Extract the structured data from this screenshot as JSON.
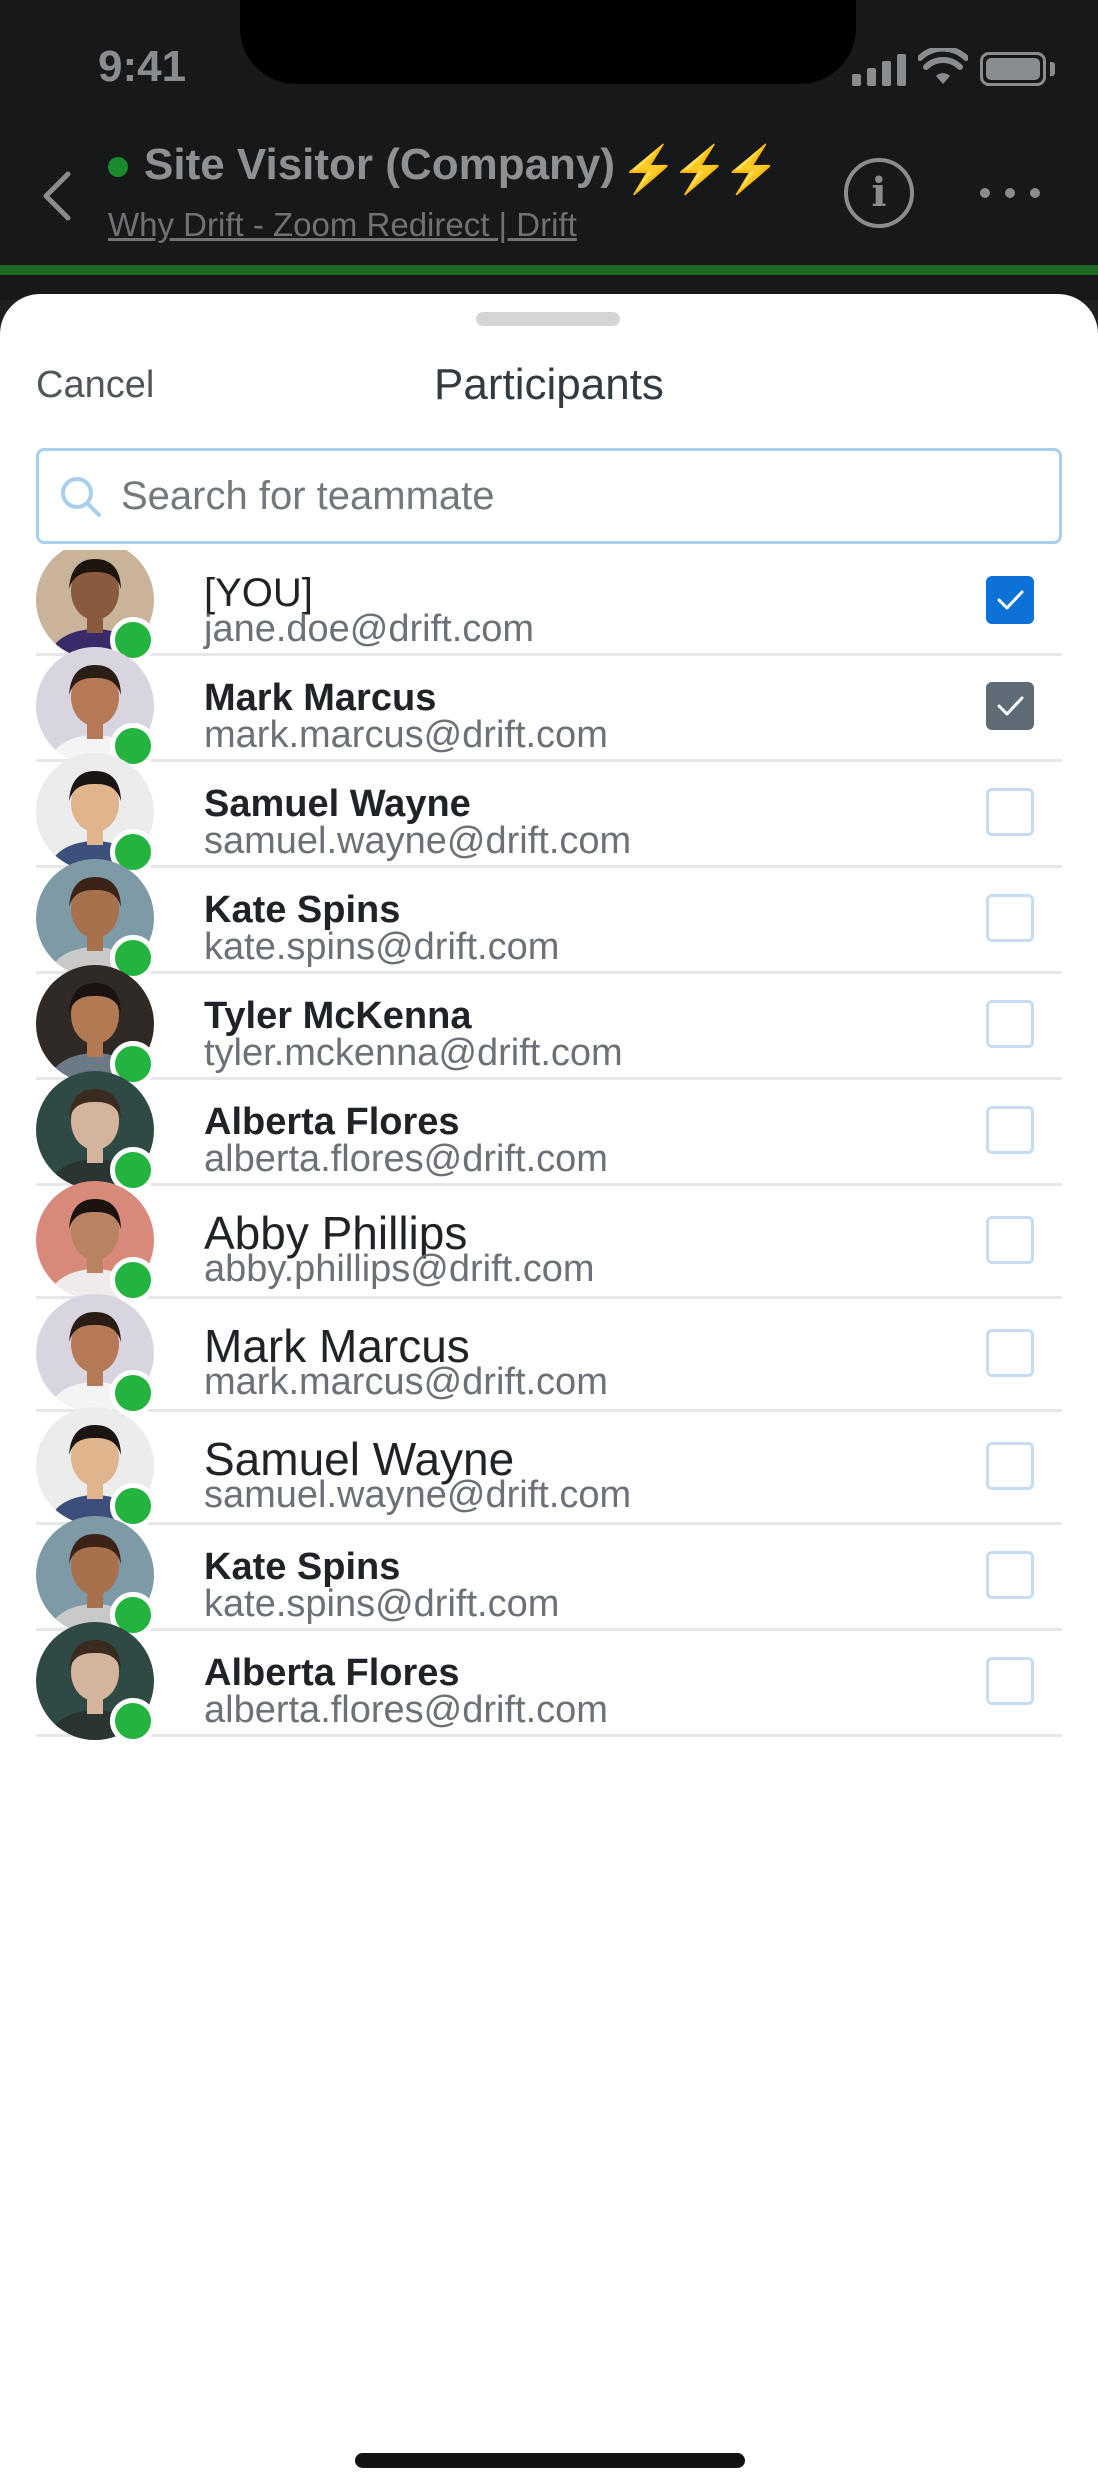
{
  "status_bar": {
    "time": "9:41"
  },
  "conversation": {
    "title": "Site Visitor (Company)",
    "bolts": "⚡⚡⚡",
    "subtitle": "Why Drift - Zoom Redirect | Drift",
    "colors": {
      "online": "#1a8a2c",
      "stripe": "#1f6a22"
    }
  },
  "sheet": {
    "cancel_label": "Cancel",
    "title": "Participants",
    "search": {
      "placeholder": "Search for teammate",
      "value": ""
    }
  },
  "participants": [
    {
      "name": "[YOU]",
      "email": "jane.doe@drift.com",
      "checked": true,
      "check_style": "blue",
      "avatar": "avatar-jane",
      "name_style": "regular"
    },
    {
      "name": "Mark Marcus",
      "email": "mark.marcus@drift.com",
      "checked": true,
      "check_style": "gray",
      "avatar": "avatar-mark",
      "name_style": "bold"
    },
    {
      "name": "Samuel Wayne",
      "email": "samuel.wayne@drift.com",
      "checked": false,
      "avatar": "avatar-samuel",
      "name_style": "bold"
    },
    {
      "name": "Kate Spins",
      "email": "kate.spins@drift.com",
      "checked": false,
      "avatar": "avatar-kate",
      "name_style": "bold"
    },
    {
      "name": "Tyler McKenna",
      "email": "tyler.mckenna@drift.com",
      "checked": false,
      "avatar": "avatar-tyler",
      "name_style": "bold"
    },
    {
      "name": "Alberta Flores",
      "email": "alberta.flores@drift.com",
      "checked": false,
      "avatar": "avatar-alberta",
      "name_style": "bold"
    },
    {
      "name": "Abby Phillips",
      "email": "abby.phillips@drift.com",
      "checked": false,
      "avatar": "avatar-abby",
      "name_style": "big"
    },
    {
      "name": "Mark Marcus",
      "email": "mark.marcus@drift.com",
      "checked": false,
      "avatar": "avatar-mark",
      "name_style": "big"
    },
    {
      "name": "Samuel Wayne",
      "email": "samuel.wayne@drift.com",
      "checked": false,
      "avatar": "avatar-samuel",
      "name_style": "big"
    },
    {
      "name": "Kate Spins",
      "email": "kate.spins@drift.com",
      "checked": false,
      "avatar": "avatar-kate",
      "name_style": "bold"
    },
    {
      "name": "Alberta Flores",
      "email": "alberta.flores@drift.com",
      "checked": false,
      "avatar": "avatar-alberta",
      "name_style": "bold"
    }
  ],
  "colors": {
    "accent": "#0d72d8",
    "presence": "#24b33e",
    "search_border": "#a9cfee"
  }
}
